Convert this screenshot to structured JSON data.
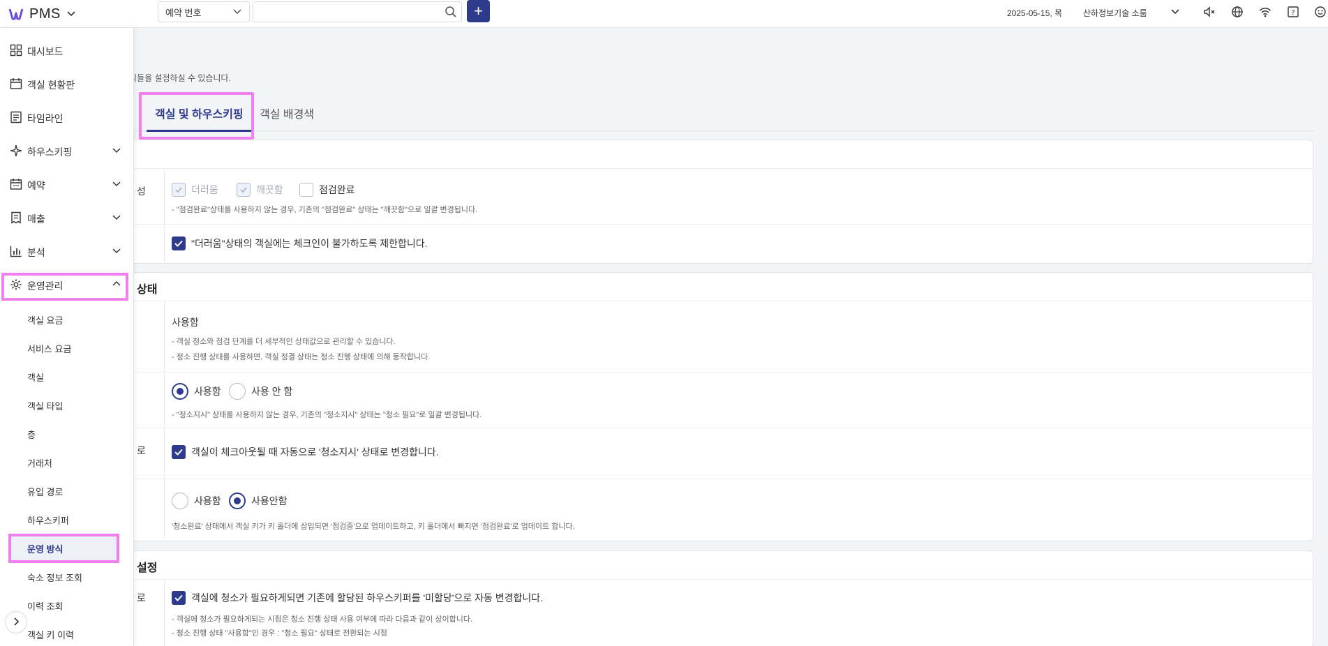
{
  "app": {
    "name": "PMS",
    "brand_color": "#2e3a8c",
    "highlight_color": "#f07ff0"
  },
  "topbar": {
    "search_select_value": "예약 번호",
    "search_placeholder": "",
    "add_label": "+",
    "date": "2025-05-15, 목",
    "store": "산하정보기술 소룸",
    "icons": [
      "mute-icon",
      "globe-icon",
      "wifi-icon",
      "help-icon",
      "smile-icon"
    ]
  },
  "sidebar": {
    "items": [
      {
        "label": "대시보드",
        "icon": "dashboard-icon"
      },
      {
        "label": "객실 현황판",
        "icon": "calendar-icon"
      },
      {
        "label": "타임라인",
        "icon": "timeline-icon"
      },
      {
        "label": "하우스키핑",
        "icon": "sparkle-icon"
      },
      {
        "label": "예약",
        "icon": "reservation-icon"
      },
      {
        "label": "매출",
        "icon": "receipt-icon"
      },
      {
        "label": "분석",
        "icon": "chart-icon"
      },
      {
        "label": "운영관리",
        "icon": "gear-icon"
      }
    ],
    "sub_items": [
      "객실 요금",
      "서비스 요금",
      "객실",
      "객실 타입",
      "층",
      "거래처",
      "유입 경로",
      "하우스키퍼",
      "운영 방식",
      "숙소 정보 조회",
      "이력 조회",
      "객실 키 이력"
    ]
  },
  "main": {
    "description": "직들을 설정하실 수 있습니다.",
    "tabs": [
      "객실 및 하우스키핑",
      "객실 배경색"
    ],
    "card1": {
      "row1_label": "성",
      "options": [
        "더러움",
        "깨끗함",
        "점검완료"
      ],
      "row1_note": "- \"점검완료\"상태를 사용하지 않는 경우, 기존의 \"점검완료\" 상태는 \"깨끗함\"으로 일괄 변경됩니다.",
      "row2_text": "\"더러움\"상태의 객실에는 체크인이 불가하도록 제한합니다."
    },
    "card2": {
      "title": "상태",
      "row1_value": "사용함",
      "row1_note1": "- 객실 청소와 점검 단계를 더 세부적인 상태값으로 관리할 수 있습니다.",
      "row1_note2": "- 청소 진행 상태를 사용하면, 객실 청결 상태는 청소 진행 상태에 의해 동작합니다.",
      "row2_opt_on": "사용함",
      "row2_opt_off": "사용 안 함",
      "row2_note": "- \"청소지시\" 상태를 사용하지 않는 경우, 기존의 \"청소지시\" 상태는 \"청소 필요\"로 일괄 변경됩니다.",
      "row3_label": "로",
      "row3_text": "객실이 체크아웃될 때 자동으로 '청소지시' 상태로 변경합니다.",
      "row4_opt_a": "사용함",
      "row4_opt_b": "사용안함",
      "row4_note": "'청소완료' 상태에서 객실 키가 키 홀더에 삽입되면 '점검중'으로 업데이트하고, 키 홀더에서 빠지면 '점검완료'로 업데이트 합니다."
    },
    "card3": {
      "title": "설정",
      "row1_label": "로",
      "row1_text": "객실에 청소가 필요하게되면 기존에 할당된 하우스키퍼를 '미할당'으로 자동 변경합니다.",
      "row1_note1": "- 객실에 청소가 필요하게되는 시점은 청소 진행 상태 사용 여부에 따라 다음과 같이 상이합니다.",
      "row1_note2": "- 청소 진행 상태 \"사용함\"인 경우 : \"청소 필요\" 상태로 전환되는 시점"
    }
  }
}
